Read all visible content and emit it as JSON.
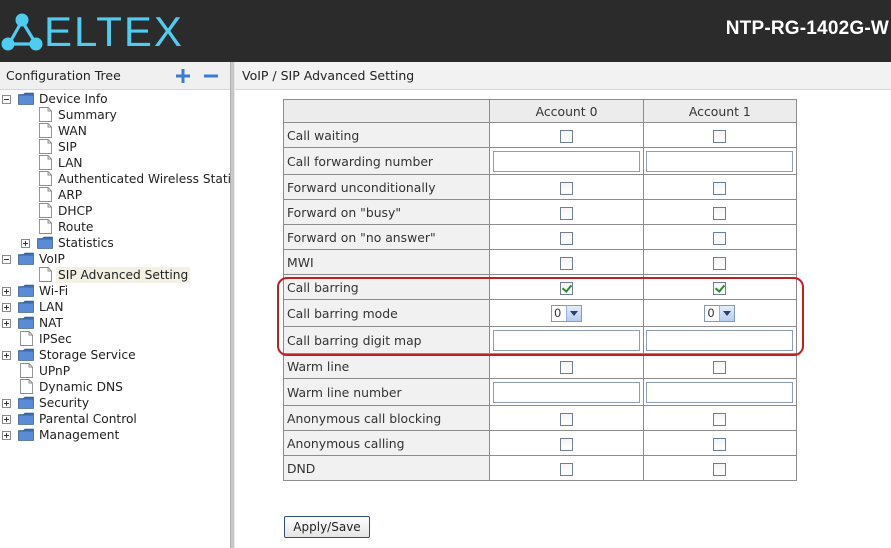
{
  "header": {
    "brand": "ELTEX",
    "model": "NTP-RG-1402G-W",
    "logo_color": "#4ecdf0"
  },
  "sidebar": {
    "title": "Configuration Tree",
    "expand_all_icon": "plus-icon",
    "collapse_all_icon": "minus-icon",
    "nodes": [
      {
        "label": "Device Info",
        "type": "folder",
        "expander": "minus",
        "level": 0
      },
      {
        "label": "Summary",
        "type": "doc",
        "level": 1
      },
      {
        "label": "WAN",
        "type": "doc",
        "level": 1
      },
      {
        "label": "SIP",
        "type": "doc",
        "level": 1
      },
      {
        "label": "LAN",
        "type": "doc",
        "level": 1
      },
      {
        "label": "Authenticated Wireless Static",
        "type": "doc",
        "level": 1
      },
      {
        "label": "ARP",
        "type": "doc",
        "level": 1
      },
      {
        "label": "DHCP",
        "type": "doc",
        "level": 1
      },
      {
        "label": "Route",
        "type": "doc",
        "level": 1
      },
      {
        "label": "Statistics",
        "type": "folder",
        "expander": "plus",
        "level": 1
      },
      {
        "label": "VoIP",
        "type": "folder",
        "expander": "minus",
        "level": 0
      },
      {
        "label": "SIP Advanced Setting",
        "type": "doc",
        "level": 1,
        "selected": true
      },
      {
        "label": "Wi-Fi",
        "type": "folder",
        "expander": "plus",
        "level": 0
      },
      {
        "label": "LAN",
        "type": "folder",
        "expander": "plus",
        "level": 0
      },
      {
        "label": "NAT",
        "type": "folder",
        "expander": "plus",
        "level": 0
      },
      {
        "label": "IPSec",
        "type": "doc",
        "level": 0
      },
      {
        "label": "Storage Service",
        "type": "folder",
        "expander": "plus",
        "level": 0
      },
      {
        "label": "UPnP",
        "type": "doc",
        "level": 0
      },
      {
        "label": "Dynamic DNS",
        "type": "doc",
        "level": 0
      },
      {
        "label": "Security",
        "type": "folder",
        "expander": "plus",
        "level": 0
      },
      {
        "label": "Parental Control",
        "type": "folder",
        "expander": "plus",
        "level": 0
      },
      {
        "label": "Management",
        "type": "folder",
        "expander": "plus",
        "level": 0
      }
    ]
  },
  "content": {
    "breadcrumb": "VoIP / SIP Advanced Setting",
    "columns": [
      "Account 0",
      "Account 1"
    ],
    "rows": [
      {
        "label": "Call waiting",
        "kind": "checkbox",
        "values": [
          false,
          false
        ]
      },
      {
        "label": "Call forwarding number",
        "kind": "text",
        "values": [
          "",
          ""
        ]
      },
      {
        "label": "Forward unconditionally",
        "kind": "checkbox",
        "values": [
          false,
          false
        ]
      },
      {
        "label": "Forward on \"busy\"",
        "kind": "checkbox",
        "values": [
          false,
          false
        ]
      },
      {
        "label": "Forward on \"no answer\"",
        "kind": "checkbox",
        "values": [
          false,
          false
        ]
      },
      {
        "label": "MWI",
        "kind": "checkbox",
        "values": [
          false,
          false
        ]
      },
      {
        "label": "Call barring",
        "kind": "checkbox",
        "values": [
          true,
          true
        ]
      },
      {
        "label": "Call barring mode",
        "kind": "select",
        "values": [
          "0",
          "0"
        ]
      },
      {
        "label": "Call barring digit map",
        "kind": "text",
        "values": [
          "",
          ""
        ]
      },
      {
        "label": "Warm line",
        "kind": "checkbox",
        "values": [
          false,
          false
        ]
      },
      {
        "label": "Warm line number",
        "kind": "text",
        "values": [
          "",
          ""
        ]
      },
      {
        "label": "Anonymous call blocking",
        "kind": "checkbox",
        "values": [
          false,
          false
        ]
      },
      {
        "label": "Anonymous calling",
        "kind": "checkbox",
        "values": [
          false,
          false
        ]
      },
      {
        "label": "DND",
        "kind": "checkbox",
        "values": [
          false,
          false
        ]
      }
    ],
    "apply_label": "Apply/Save",
    "highlight_color": "#c02025"
  }
}
